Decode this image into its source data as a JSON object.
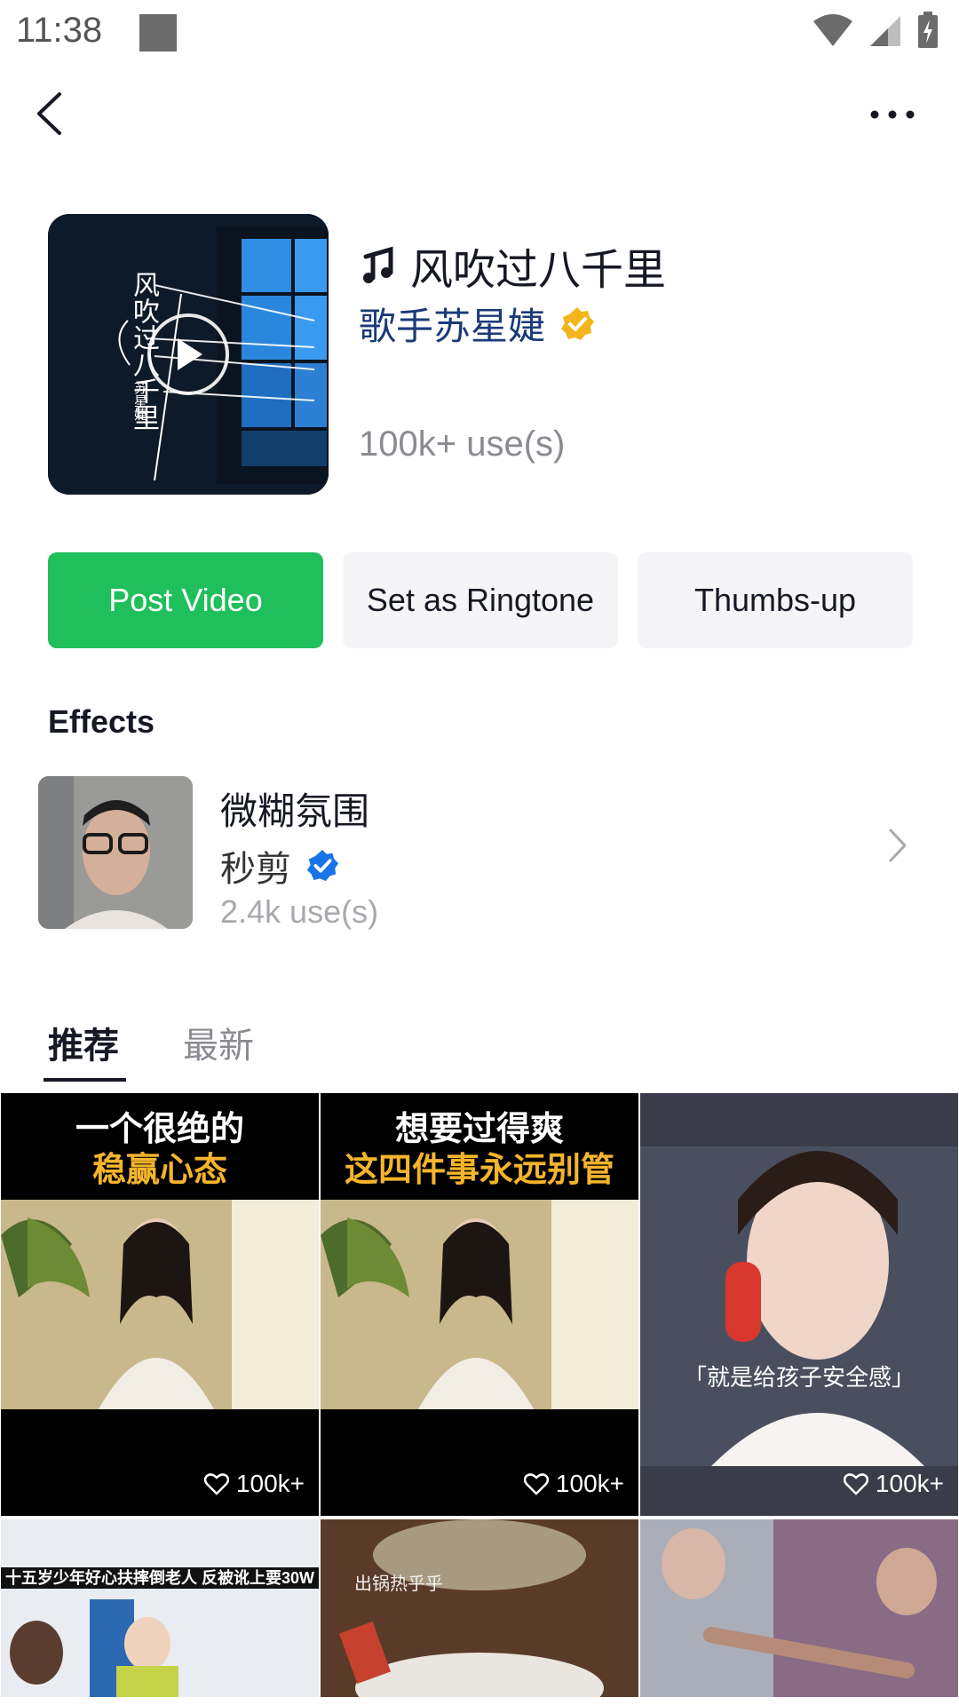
{
  "status_bar": {
    "time": "11:38"
  },
  "music": {
    "title": "风吹过八千里",
    "artist": "歌手苏星婕",
    "uses": "100k+ use(s)",
    "cover": {
      "text_vertical": "风吹过八千里",
      "artist_vertical": "苏星婕"
    }
  },
  "buttons": {
    "post_video": "Post Video",
    "set_ringtone": "Set as Ringtone",
    "thumbs_up": "Thumbs-up"
  },
  "effects": {
    "heading": "Effects",
    "item": {
      "name": "微糊氛围",
      "creator": "秒剪",
      "uses": "2.4k use(s)"
    }
  },
  "tabs": {
    "recommended": "推荐",
    "latest": "最新"
  },
  "videos": [
    {
      "caption_line1": "一个很绝的",
      "caption_line2": "稳赢心态",
      "likes": "100k+"
    },
    {
      "caption_line1": "想要过得爽",
      "caption_line2": "这四件事永远别管",
      "likes": "100k+"
    },
    {
      "subtitle": "「就是给孩子安全感」",
      "likes": "100k+"
    },
    {
      "caption": "十五岁少年好心扶摔倒老人 反被讹上要30W"
    },
    {
      "overlay_text": "出锅热乎乎"
    },
    {}
  ],
  "colors": {
    "accent_green": "#1fbf5b",
    "verified_gold": "#f3b51b",
    "verified_blue": "#1a73e8",
    "artist_blue": "#1a3a78",
    "muted_gray": "#8a8b91"
  }
}
